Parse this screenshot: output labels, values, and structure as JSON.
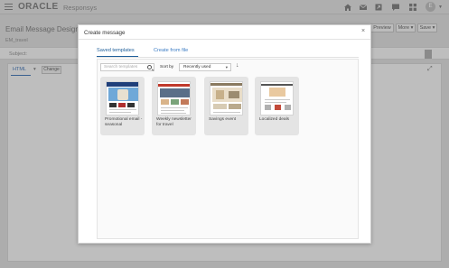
{
  "topbar": {
    "brand": "ORACLE",
    "product": "Responsys",
    "avatar_initial": "E",
    "icons": [
      "home-icon",
      "mail-icon",
      "share-icon",
      "chat-icon",
      "grid-icon"
    ]
  },
  "background_page": {
    "title": "Email Message Designer",
    "file": "EM_travel",
    "buttons": {
      "preview": "Preview",
      "more": "More ▾",
      "save": "Save ▾"
    },
    "subject_label": "Subject:",
    "html_tab": "HTML",
    "html_caret": "▾",
    "change_button": "Change"
  },
  "dialog": {
    "title": "Create message",
    "close_glyph": "×",
    "tabs": [
      {
        "label": "Saved templates"
      },
      {
        "label": "Create from file"
      }
    ],
    "search": {
      "placeholder": "Search templates"
    },
    "sort": {
      "label": "Sort by",
      "selected": "Recently used",
      "caret": "▾",
      "direction_glyph": "↓"
    },
    "templates": [
      {
        "label": "Promotional email - seasonal"
      },
      {
        "label": "Weekly newsletter for travel"
      },
      {
        "label": "Savings event"
      },
      {
        "label": "Localized deals"
      }
    ]
  },
  "colors": {
    "accent": "#1f5f9a",
    "link": "#3b7cc4",
    "topbar": "#dcdcdc",
    "card": "#e4e4e4"
  }
}
